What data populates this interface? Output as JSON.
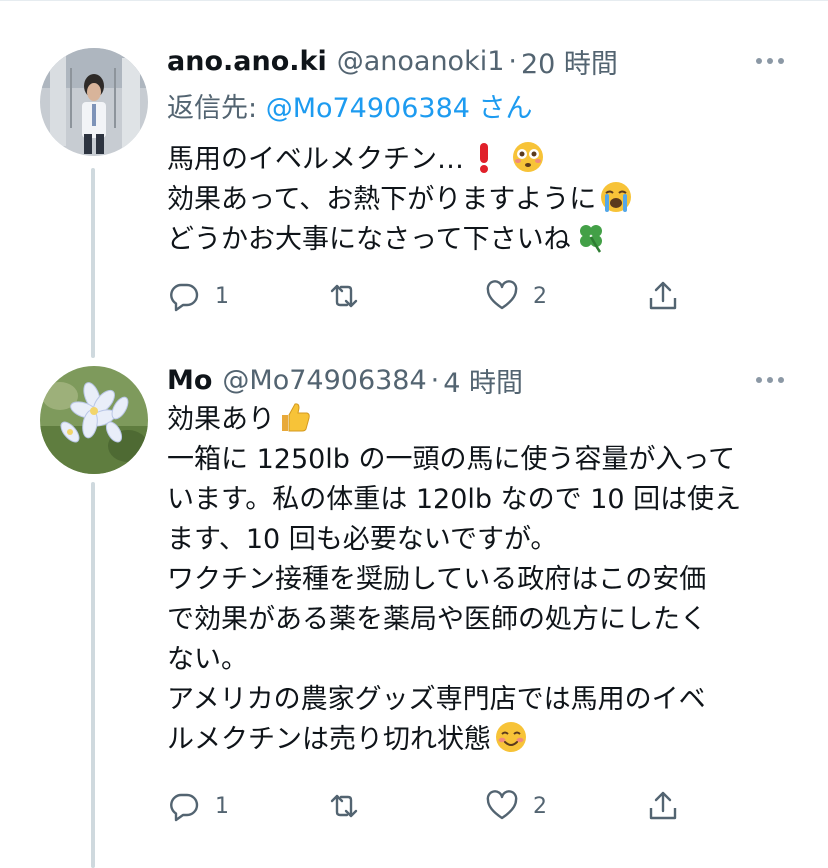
{
  "tweets": [
    {
      "display_name": "ano.ano.ki",
      "handle": "@anoanoki1",
      "separator": "·",
      "time": "20 時間",
      "reply_prefix": "返信先: ",
      "reply_mention": "@Mo74906384",
      "reply_suffix": " さん",
      "lines": [
        "馬用のイベルメクチン…",
        "効果あって、お熱下がりますように",
        "どうかお大事になさって下さいね"
      ],
      "emojis": [
        "exclamation-emoji",
        "flushed-face-emoji",
        "loudly-crying-face-emoji",
        "four-leaf-clover-emoji"
      ],
      "reply_count": "1",
      "retweet_count": "",
      "like_count": "2"
    },
    {
      "display_name": "Mo",
      "handle": "@Mo74906384",
      "separator": "·",
      "time": "4 時間",
      "lines": [
        "効果あり",
        "一箱に 1250lb の一頭の馬に使う容量が入って",
        "います。私の体重は 120lb なので 10 回は使え",
        "ます、10 回も必要ないですが。",
        "ワクチン接種を奨励している政府はこの安価",
        "で効果がある薬を薬局や医師の処方にしたく",
        "ない。",
        "アメリカの農家グッズ専門店では馬用のイベ",
        "ルメクチンは売り切れ状態"
      ],
      "emojis": [
        "thumbs-up-emoji",
        "smiling-face-emoji"
      ],
      "reply_count": "1",
      "retweet_count": "",
      "like_count": "2"
    }
  ],
  "colors": {
    "text": "#0f1419",
    "secondary": "#536471",
    "link": "#1d9bf0",
    "thread_line": "#cfd9de",
    "divider": "#e6ecf0"
  },
  "icons": [
    "reply-icon",
    "retweet-icon",
    "like-icon",
    "share-icon",
    "more-icon"
  ]
}
